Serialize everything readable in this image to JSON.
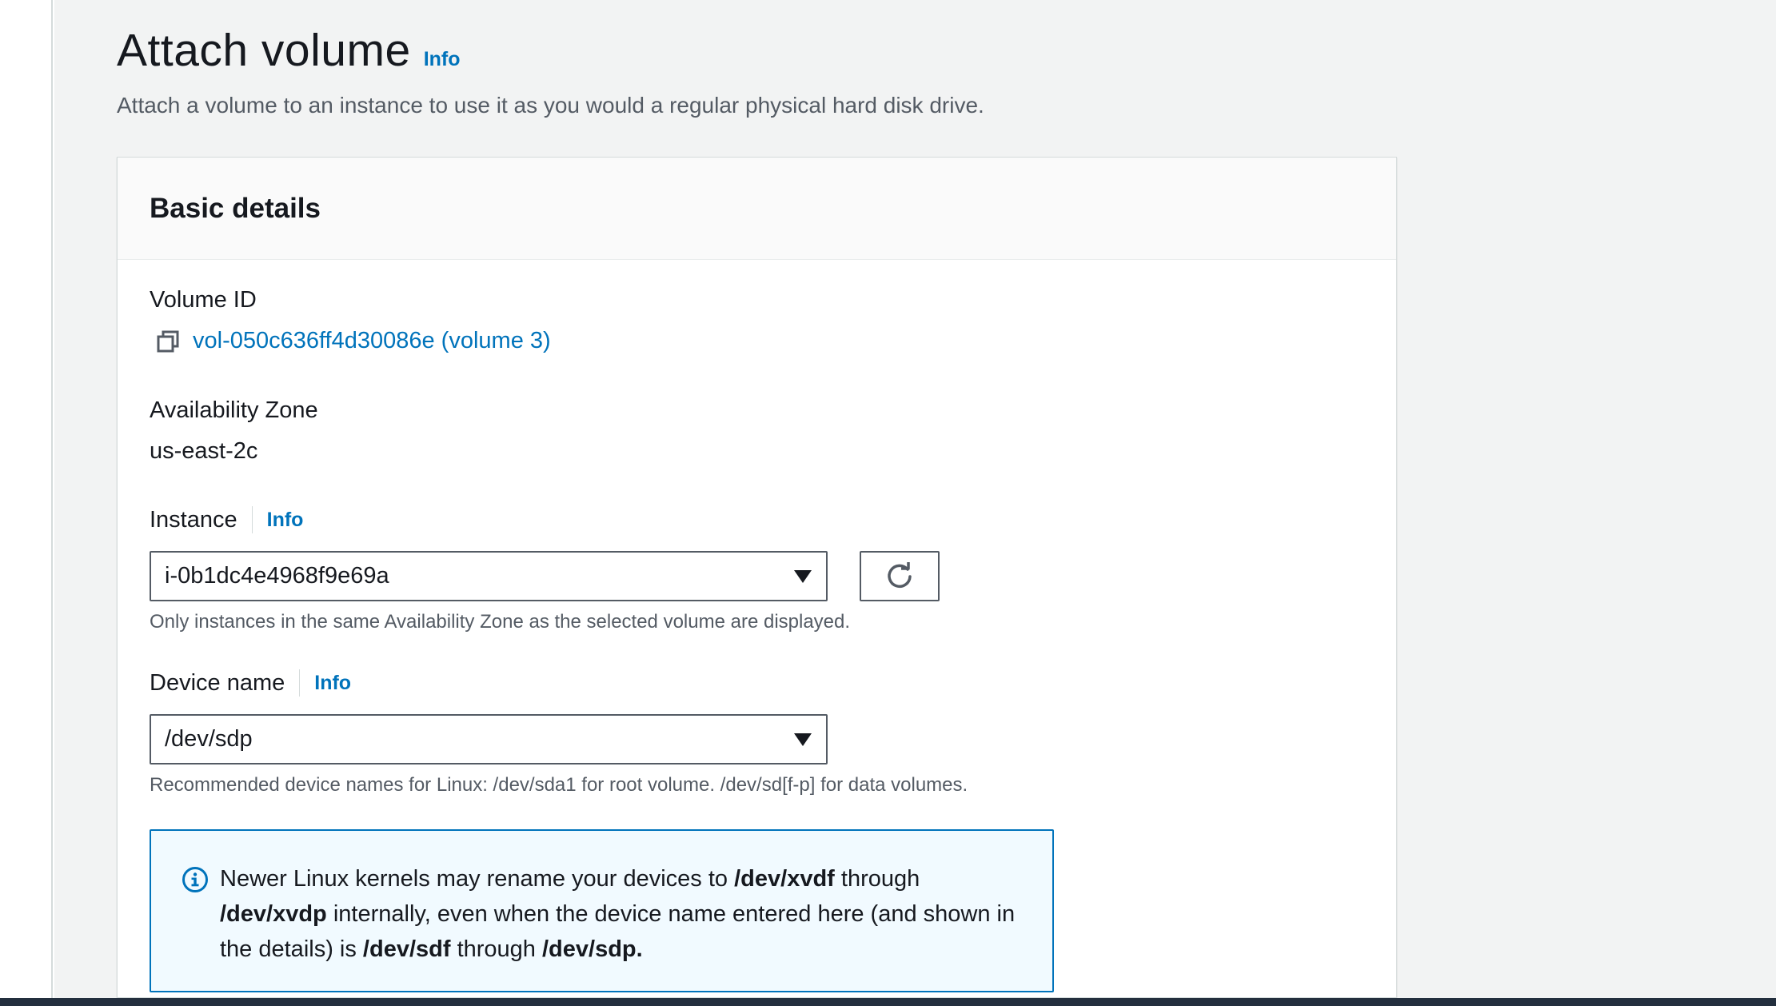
{
  "header": {
    "title": "Attach volume",
    "info_label": "Info",
    "description": "Attach a volume to an instance to use it as you would a regular physical hard disk drive."
  },
  "basic_details": {
    "title": "Basic details",
    "volume_id": {
      "label": "Volume ID",
      "value": "vol-050c636ff4d30086e (volume 3)",
      "icon": "copy-icon"
    },
    "availability_zone": {
      "label": "Availability Zone",
      "value": "us-east-2c"
    },
    "instance": {
      "label": "Instance",
      "info_label": "Info",
      "selected": "i-0b1dc4e4968f9e69a",
      "hint": "Only instances in the same Availability Zone as the selected volume are displayed.",
      "refresh_icon": "refresh-icon"
    },
    "device_name": {
      "label": "Device name",
      "info_label": "Info",
      "selected": "/dev/sdp",
      "hint": "Recommended device names for Linux: /dev/sda1 for root volume. /dev/sd[f-p] for data volumes."
    },
    "alert": {
      "icon": "info-circle-icon",
      "part1": "Newer Linux kernels may rename your devices to ",
      "bold1": "/dev/xvdf",
      "part2": " through ",
      "bold2": "/dev/xvdp",
      "part3": " internally, even when the device name entered here (and shown in the details) is ",
      "bold3": "/dev/sdf",
      "part4": " through ",
      "bold4": "/dev/sdp."
    }
  },
  "colors": {
    "link": "#0073bb",
    "page_background": "#f2f3f3",
    "alert_background": "#f1faff",
    "bottom_bar": "#232f3e"
  }
}
